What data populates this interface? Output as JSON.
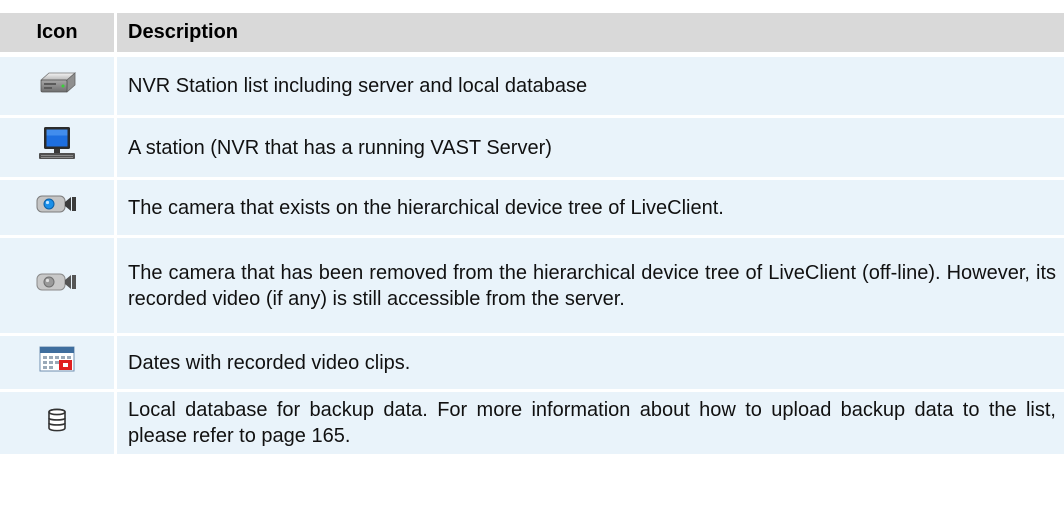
{
  "table": {
    "headers": {
      "icon": "Icon",
      "description": "Description"
    },
    "rows": [
      {
        "icon": "nvr-station-list-icon",
        "description": "NVR Station list including server and local database"
      },
      {
        "icon": "station-monitor-icon",
        "description": "A station (NVR that has a running VAST Server)"
      },
      {
        "icon": "camera-online-icon",
        "description": "The camera that exists on the hierarchical device tree of LiveClient."
      },
      {
        "icon": "camera-offline-icon",
        "description": "The camera that has been removed from the hierarchical device tree of LiveClient (off-line). However, its recorded video (if any) is still accessible from the server."
      },
      {
        "icon": "calendar-icon",
        "description": "Dates with recorded video clips."
      },
      {
        "icon": "database-icon",
        "description": "Local database for backup data. For more information about how to upload backup data to the list, please refer to page 165."
      }
    ]
  },
  "colors": {
    "header_bg": "#d9d9d9",
    "row_bg": "#e9f3fa",
    "camera_lens_online": "#1a8fe8",
    "camera_lens_offline": "#9a9a9a",
    "monitor_screen": "#1e6fe0",
    "calendar_mark": "#e02020"
  }
}
